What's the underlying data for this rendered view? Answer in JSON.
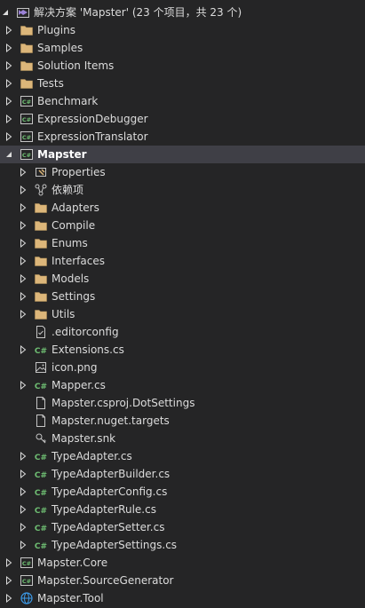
{
  "solution": {
    "title": "解决方案 'Mapster' (23 个项目，共 23 个)"
  },
  "items": [
    {
      "label": "Plugins",
      "icon": "folder-icon",
      "depth": 0,
      "arrow": "collapsed"
    },
    {
      "label": "Samples",
      "icon": "folder-icon",
      "depth": 0,
      "arrow": "collapsed"
    },
    {
      "label": "Solution Items",
      "icon": "folder-icon",
      "depth": 0,
      "arrow": "collapsed"
    },
    {
      "label": "Tests",
      "icon": "folder-icon",
      "depth": 0,
      "arrow": "collapsed"
    },
    {
      "label": "Benchmark",
      "icon": "csharp-project-icon",
      "depth": 0,
      "arrow": "collapsed"
    },
    {
      "label": "ExpressionDebugger",
      "icon": "csharp-project-icon",
      "depth": 0,
      "arrow": "collapsed"
    },
    {
      "label": "ExpressionTranslator",
      "icon": "csharp-project-icon",
      "depth": 0,
      "arrow": "collapsed"
    },
    {
      "label": "Mapster",
      "icon": "csharp-project-icon",
      "depth": 0,
      "arrow": "expanded",
      "selected": true
    },
    {
      "label": "Properties",
      "icon": "properties-icon",
      "depth": 1,
      "arrow": "collapsed"
    },
    {
      "label": "依赖项",
      "icon": "dependencies-icon",
      "depth": 1,
      "arrow": "collapsed"
    },
    {
      "label": "Adapters",
      "icon": "folder-icon",
      "depth": 1,
      "arrow": "collapsed"
    },
    {
      "label": "Compile",
      "icon": "folder-icon",
      "depth": 1,
      "arrow": "collapsed"
    },
    {
      "label": "Enums",
      "icon": "folder-icon",
      "depth": 1,
      "arrow": "collapsed"
    },
    {
      "label": "Interfaces",
      "icon": "folder-icon",
      "depth": 1,
      "arrow": "collapsed"
    },
    {
      "label": "Models",
      "icon": "folder-icon",
      "depth": 1,
      "arrow": "collapsed"
    },
    {
      "label": "Settings",
      "icon": "folder-icon",
      "depth": 1,
      "arrow": "collapsed"
    },
    {
      "label": "Utils",
      "icon": "folder-icon",
      "depth": 1,
      "arrow": "collapsed"
    },
    {
      "label": ".editorconfig",
      "icon": "config-file-icon",
      "depth": 1,
      "arrow": "none"
    },
    {
      "label": "Extensions.cs",
      "icon": "csharp-file-icon",
      "depth": 1,
      "arrow": "collapsed"
    },
    {
      "label": "icon.png",
      "icon": "image-file-icon",
      "depth": 1,
      "arrow": "none"
    },
    {
      "label": "Mapper.cs",
      "icon": "csharp-file-icon",
      "depth": 1,
      "arrow": "collapsed"
    },
    {
      "label": "Mapster.csproj.DotSettings",
      "icon": "file-icon",
      "depth": 1,
      "arrow": "none"
    },
    {
      "label": "Mapster.nuget.targets",
      "icon": "file-icon",
      "depth": 1,
      "arrow": "none"
    },
    {
      "label": "Mapster.snk",
      "icon": "key-file-icon",
      "depth": 1,
      "arrow": "none"
    },
    {
      "label": "TypeAdapter.cs",
      "icon": "csharp-file-icon",
      "depth": 1,
      "arrow": "collapsed"
    },
    {
      "label": "TypeAdapterBuilder.cs",
      "icon": "csharp-file-icon",
      "depth": 1,
      "arrow": "collapsed"
    },
    {
      "label": "TypeAdapterConfig.cs",
      "icon": "csharp-file-icon",
      "depth": 1,
      "arrow": "collapsed"
    },
    {
      "label": "TypeAdapterRule.cs",
      "icon": "csharp-file-icon",
      "depth": 1,
      "arrow": "collapsed"
    },
    {
      "label": "TypeAdapterSetter.cs",
      "icon": "csharp-file-icon",
      "depth": 1,
      "arrow": "collapsed"
    },
    {
      "label": "TypeAdapterSettings.cs",
      "icon": "csharp-file-icon",
      "depth": 1,
      "arrow": "collapsed"
    },
    {
      "label": "Mapster.Core",
      "icon": "csharp-project-icon",
      "depth": 0,
      "arrow": "collapsed"
    },
    {
      "label": "Mapster.SourceGenerator",
      "icon": "csharp-project-icon",
      "depth": 0,
      "arrow": "collapsed"
    },
    {
      "label": "Mapster.Tool",
      "icon": "web-project-icon",
      "depth": 0,
      "arrow": "collapsed"
    }
  ],
  "colors": {
    "background": "#252526",
    "selection": "#3f3f46",
    "text": "#dcdcdc",
    "folder": "#dcb67a",
    "csharp": "#6fbf73",
    "solution": "#9b82d6",
    "web": "#3c9ae8"
  }
}
